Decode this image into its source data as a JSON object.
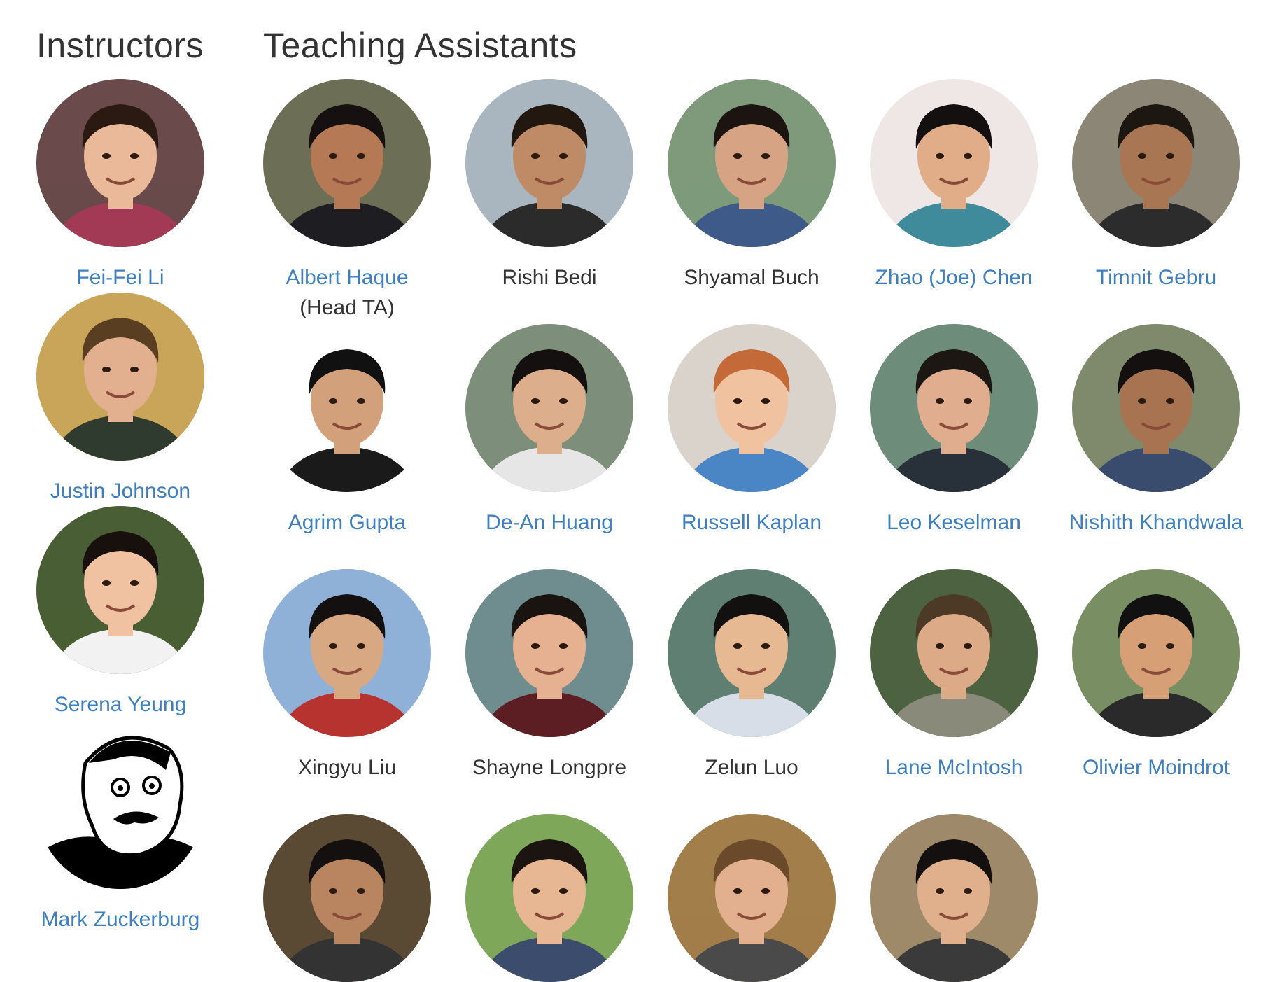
{
  "headings": {
    "instructors": "Instructors",
    "tas": "Teaching Assistants"
  },
  "instructors": [
    {
      "name": "Fei-Fei Li",
      "linked": true,
      "bg": "#6a4a4a",
      "skin": "#e9b99a",
      "hair": "#2a1a12",
      "shirt": "#a33a55"
    },
    {
      "name": "Justin Johnson",
      "linked": true,
      "bg": "#c9a55a",
      "skin": "#e3b08f",
      "hair": "#5a3e22",
      "shirt": "#2f3b2f"
    },
    {
      "name": "Serena Yeung",
      "linked": true,
      "bg": "#4a5e35",
      "skin": "#f0c2a2",
      "hair": "#17100c",
      "shirt": "#f2f2f2"
    },
    {
      "name": "Mark Zuckerburg",
      "linked": true,
      "bg": "#ffffff",
      "skin": "#ffffff",
      "hair": "#000000",
      "shirt": "#000000",
      "meme": true
    }
  ],
  "tas": [
    {
      "name": "Albert Haque",
      "role": "(Head TA)",
      "linked": true,
      "bg": "#6c6f55",
      "skin": "#b57a55",
      "hair": "#161010",
      "shirt": "#1e1e22"
    },
    {
      "name": "Rishi Bedi",
      "linked": false,
      "bg": "#a9b6bf",
      "skin": "#bf8a66",
      "hair": "#231810",
      "shirt": "#2b2b2b"
    },
    {
      "name": "Shyamal Buch",
      "linked": false,
      "bg": "#7e9a7a",
      "skin": "#d6a485",
      "hair": "#1c1410",
      "shirt": "#3d5a88"
    },
    {
      "name": "Zhao (Joe) Chen",
      "linked": true,
      "bg": "#efe7e6",
      "skin": "#e0ad88",
      "hair": "#151010",
      "shirt": "#3f8a9b"
    },
    {
      "name": "Timnit Gebru",
      "linked": true,
      "bg": "#8c8676",
      "skin": "#a87652",
      "hair": "#1d1712",
      "shirt": "#2c2c2c"
    },
    {
      "name": "Agrim Gupta",
      "linked": true,
      "bg": "#ffffff",
      "skin": "#d3a07c",
      "hair": "#111111",
      "shirt": "#1a1a1a"
    },
    {
      "name": "De-An Huang",
      "linked": true,
      "bg": "#7d8e7a",
      "skin": "#dcae8c",
      "hair": "#151010",
      "shirt": "#e6e6e6"
    },
    {
      "name": "Russell Kaplan",
      "linked": true,
      "bg": "#d9d3cc",
      "skin": "#f0c2a0",
      "hair": "#c36a38",
      "shirt": "#4a86c5"
    },
    {
      "name": "Leo Keselman",
      "linked": true,
      "bg": "#6e8c7a",
      "skin": "#e0ae8f",
      "hair": "#1c1712",
      "shirt": "#28303a"
    },
    {
      "name": "Nishith Khandwala",
      "linked": true,
      "bg": "#7f8a6d",
      "skin": "#a87350",
      "hair": "#141010",
      "shirt": "#3a4c6e"
    },
    {
      "name": "Xingyu Liu",
      "linked": false,
      "bg": "#8fb1d8",
      "skin": "#d8a882",
      "hair": "#141010",
      "shirt": "#b7332f"
    },
    {
      "name": "Shayne Longpre",
      "linked": false,
      "bg": "#6f8c8f",
      "skin": "#e5b190",
      "hair": "#1a1410",
      "shirt": "#5c1e22"
    },
    {
      "name": "Zelun Luo",
      "linked": false,
      "bg": "#5f7f72",
      "skin": "#e6b993",
      "hair": "#131010",
      "shirt": "#d7dee8"
    },
    {
      "name": "Lane McIntosh",
      "linked": true,
      "bg": "#4d6240",
      "skin": "#dcaa86",
      "hair": "#4c3a26",
      "shirt": "#8a8a7a"
    },
    {
      "name": "Olivier Moindrot",
      "linked": true,
      "bg": "#7a8e64",
      "skin": "#d69f76",
      "hair": "#111111",
      "shirt": "#2a2a2a"
    },
    {
      "name": "",
      "linked": true,
      "bg": "#5a4a34",
      "skin": "#b98560",
      "hair": "#141010",
      "shirt": "#333333"
    },
    {
      "name": "",
      "linked": true,
      "bg": "#7fa75a",
      "skin": "#e6b792",
      "hair": "#1b1410",
      "shirt": "#3c4c6c"
    },
    {
      "name": "",
      "linked": true,
      "bg": "#a27e4a",
      "skin": "#e2b08e",
      "hair": "#6a4a2a",
      "shirt": "#4a4a4a"
    },
    {
      "name": "",
      "linked": true,
      "bg": "#9e8a6a",
      "skin": "#e0b08d",
      "hair": "#151010",
      "shirt": "#3a3a3a"
    }
  ]
}
